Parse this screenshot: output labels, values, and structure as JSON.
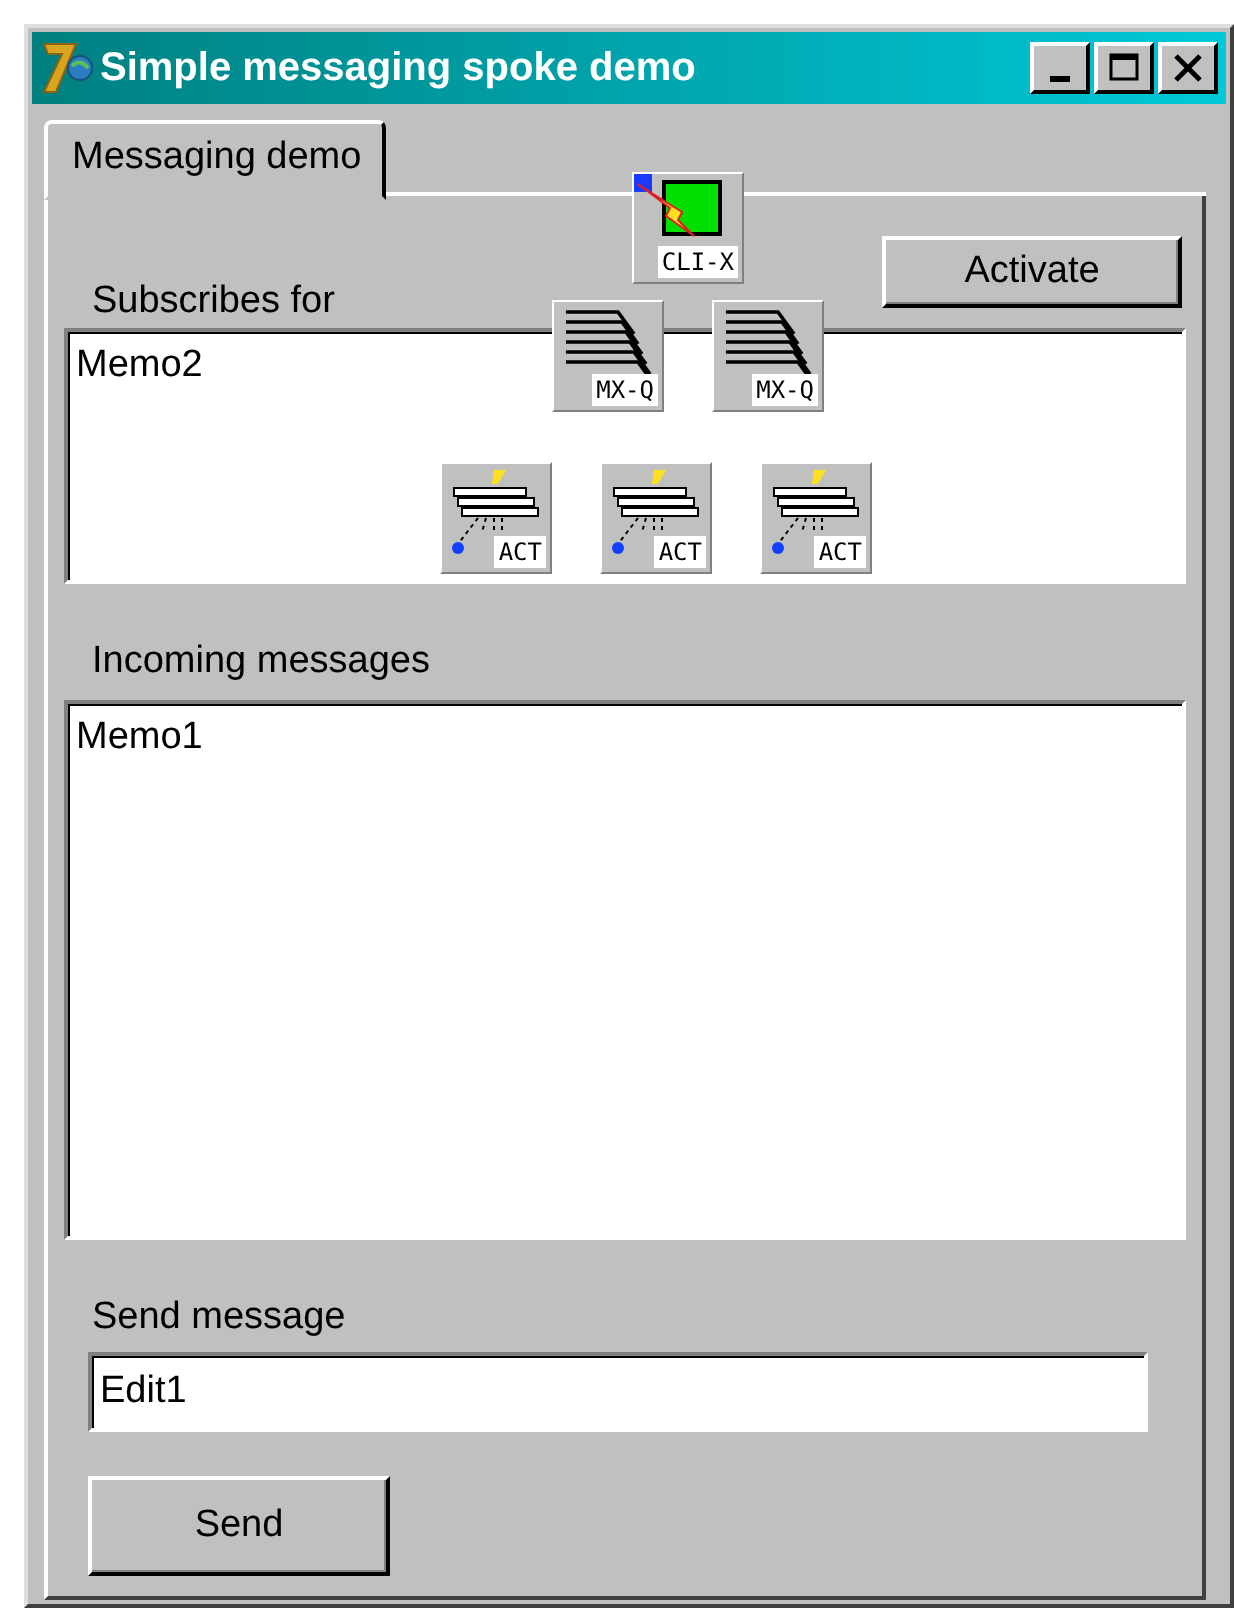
{
  "window": {
    "title": "Simple messaging spoke demo"
  },
  "tabs": [
    {
      "label": "Messaging demo",
      "selected": true
    }
  ],
  "subscribes": {
    "label": "Subscribes for",
    "value": "Memo2"
  },
  "activate_button": "Activate",
  "incoming": {
    "label": "Incoming messages",
    "value": "Memo1"
  },
  "send": {
    "label": "Send message",
    "value": "Edit1",
    "button": "Send"
  },
  "components": [
    {
      "kind": "client",
      "label": "CLI-X"
    },
    {
      "kind": "queue",
      "label": "MX-Q"
    },
    {
      "kind": "queue",
      "label": "MX-Q"
    },
    {
      "kind": "action",
      "label": "ACT"
    },
    {
      "kind": "action",
      "label": "ACT"
    },
    {
      "kind": "action",
      "label": "ACT"
    }
  ]
}
